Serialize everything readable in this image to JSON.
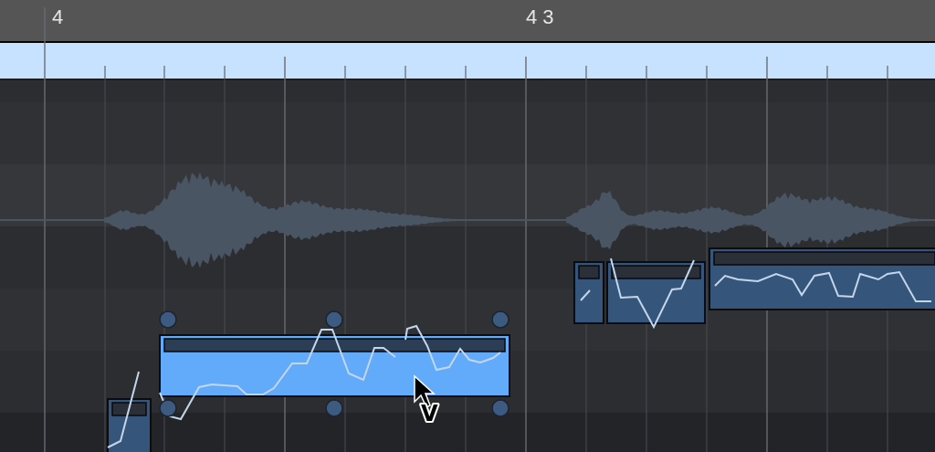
{
  "ruler": {
    "markers": [
      "4",
      "4 3"
    ]
  },
  "notes": [
    {
      "selected": false
    },
    {
      "selected": true
    },
    {
      "selected": false
    },
    {
      "selected": false
    },
    {
      "selected": false
    }
  ],
  "cursor": {
    "label": "V"
  }
}
